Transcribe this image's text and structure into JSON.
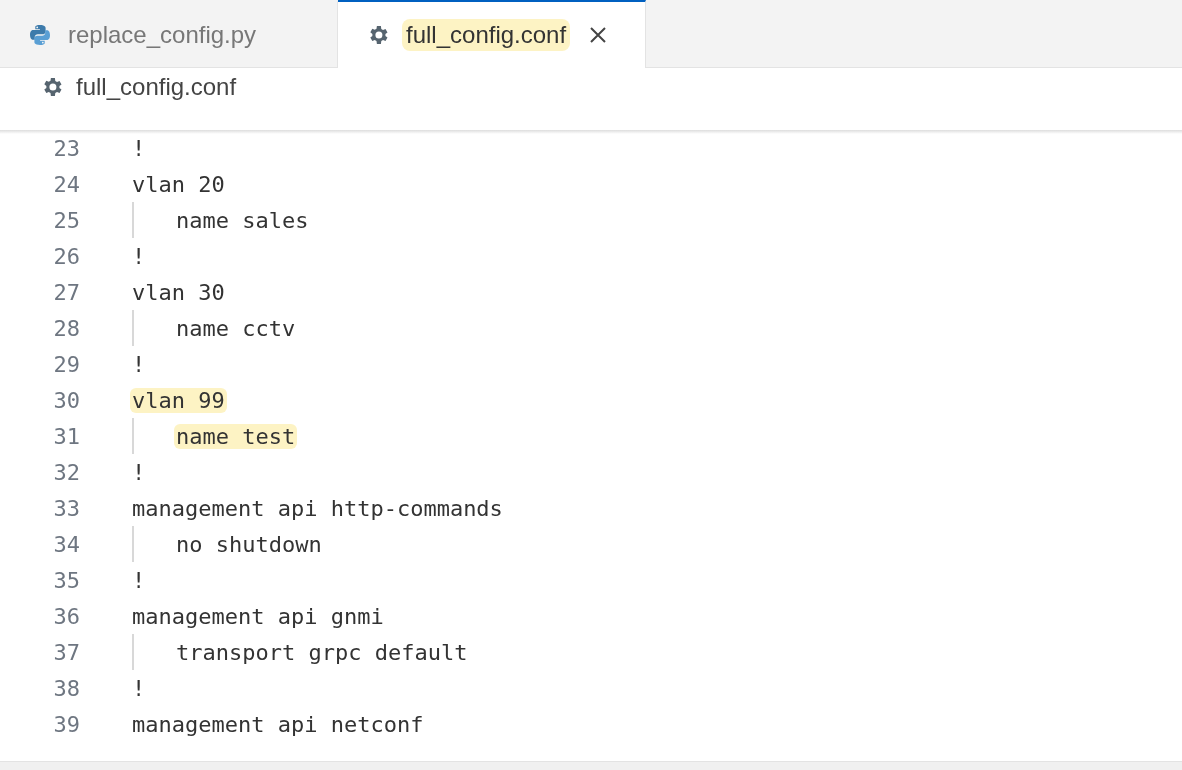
{
  "tabs": [
    {
      "label": "replace_config.py",
      "kind": "python",
      "selected": false,
      "highlighted": false
    },
    {
      "label": "full_config.conf",
      "kind": "gear",
      "selected": true,
      "highlighted": true
    }
  ],
  "breadcrumb": {
    "label": "full_config.conf",
    "kind": "gear"
  },
  "lines": [
    {
      "number": "23",
      "text": "!",
      "highlighted": false
    },
    {
      "number": "24",
      "text": "vlan 20",
      "highlighted": false,
      "children": [
        {
          "number": "25",
          "text": "name sales",
          "highlighted": false
        }
      ]
    },
    {
      "number": "26",
      "text": "!",
      "highlighted": false
    },
    {
      "number": "27",
      "text": "vlan 30",
      "highlighted": false,
      "children": [
        {
          "number": "28",
          "text": "name cctv",
          "highlighted": false
        }
      ]
    },
    {
      "number": "29",
      "text": "!",
      "highlighted": false
    },
    {
      "number": "30",
      "text": "vlan 99",
      "highlighted": true,
      "children": [
        {
          "number": "31",
          "text": "name test",
          "highlighted": true
        }
      ]
    },
    {
      "number": "32",
      "text": "!",
      "highlighted": false
    },
    {
      "number": "33",
      "text": "management api http-commands",
      "highlighted": false,
      "children": [
        {
          "number": "34",
          "text": "no shutdown",
          "highlighted": false
        }
      ]
    },
    {
      "number": "35",
      "text": "!",
      "highlighted": false
    },
    {
      "number": "36",
      "text": "management api gnmi",
      "highlighted": false,
      "children": [
        {
          "number": "37",
          "text": "transport grpc default",
          "highlighted": false
        }
      ]
    },
    {
      "number": "38",
      "text": "!",
      "highlighted": false
    },
    {
      "number": "39",
      "text": "management api netconf",
      "highlighted": false
    }
  ]
}
